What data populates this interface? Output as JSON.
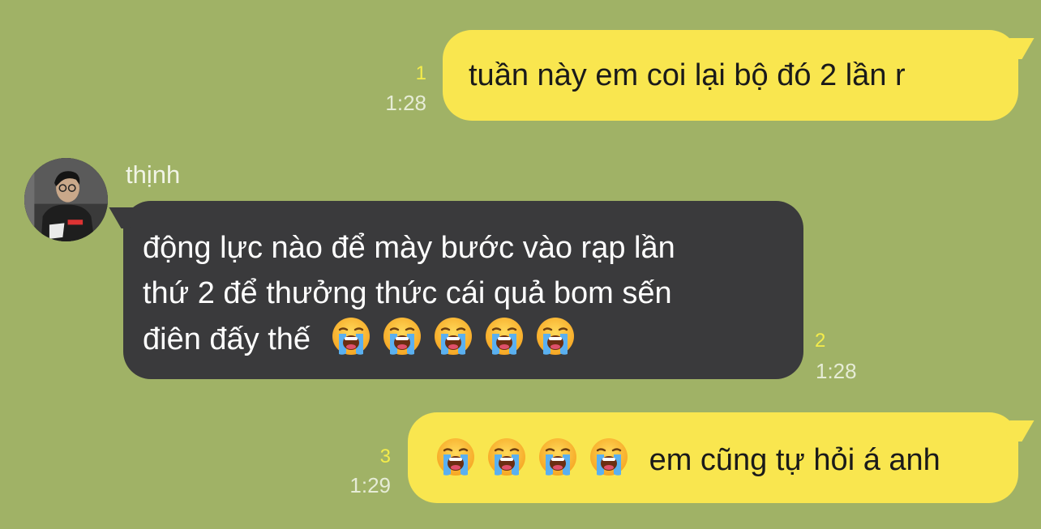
{
  "messages": [
    {
      "id": 1,
      "direction": "outgoing",
      "text": "tuần này em coi lại bộ đó 2 lần r",
      "read_count": "1",
      "time": "1:28"
    },
    {
      "id": 2,
      "direction": "incoming",
      "sender": "thịnh",
      "line1": "động lực nào để mày bước vào rạp lần",
      "line2": "thứ 2 để thưởng thức cái quả bom sến",
      "line3": "điên đấy thế",
      "emoji": "😭",
      "emoji_count": 5,
      "read_count": "2",
      "time": "1:28"
    },
    {
      "id": 3,
      "direction": "outgoing",
      "emoji": "😭",
      "emoji_count": 4,
      "text": "em cũng tự hỏi á anh",
      "read_count": "3",
      "time": "1:29"
    }
  ],
  "colors": {
    "background": "#a0b266",
    "outgoing_bubble": "#f9e64f",
    "incoming_bubble": "#3a3a3c",
    "read_count": "#f4ec4a",
    "timestamp": "#e6ecd6"
  },
  "icons": {
    "avatar": "user-avatar-photo",
    "emoji": "loudly-crying-face-emoji"
  }
}
